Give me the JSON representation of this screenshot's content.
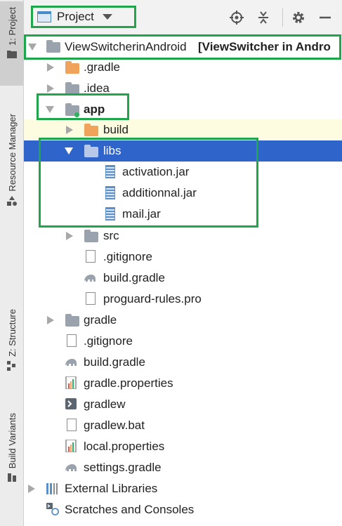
{
  "left_bar": {
    "tabs": [
      {
        "label": "1: Project",
        "active": true
      },
      {
        "label": "Resource Manager",
        "active": false
      },
      {
        "label": "Z: Structure",
        "active": false
      },
      {
        "label": "Build Variants",
        "active": false
      }
    ]
  },
  "header": {
    "view_label": "Project",
    "buttons": [
      "locate-icon",
      "collapse-all-icon",
      "gear-icon",
      "minimize-icon"
    ]
  },
  "tree": {
    "root_name": "ViewSwitcherinAndroid",
    "root_module": "[ViewSwitcher in Andro",
    "rows": [
      {
        "label": ".gradle"
      },
      {
        "label": ".idea"
      },
      {
        "label": "app"
      },
      {
        "label": "build"
      },
      {
        "label": "libs"
      },
      {
        "label": "activation.jar"
      },
      {
        "label": "additionnal.jar"
      },
      {
        "label": "mail.jar"
      },
      {
        "label": "src"
      },
      {
        "label": ".gitignore"
      },
      {
        "label": "build.gradle"
      },
      {
        "label": "proguard-rules.pro"
      },
      {
        "label": "gradle"
      },
      {
        "label": ".gitignore"
      },
      {
        "label": "build.gradle"
      },
      {
        "label": "gradle.properties"
      },
      {
        "label": "gradlew"
      },
      {
        "label": "gradlew.bat"
      },
      {
        "label": "local.properties"
      },
      {
        "label": "settings.gradle"
      },
      {
        "label": "External Libraries"
      },
      {
        "label": "Scratches and Consoles"
      }
    ]
  },
  "colors": {
    "selection": "#2f65ca",
    "highlight_box": "#1fa64a",
    "folder_orange": "#f0a35a",
    "folder_gray": "#9aa3ad"
  }
}
